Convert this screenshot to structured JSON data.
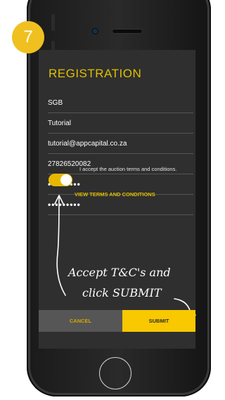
{
  "step": {
    "number": "7"
  },
  "form": {
    "title": "REGISTRATION",
    "fields": [
      {
        "value": "SGB"
      },
      {
        "value": "Tutorial"
      },
      {
        "value": "tutorial@appcapital.co.za"
      },
      {
        "value": "27826520082"
      },
      {
        "value": "•••••••••"
      },
      {
        "value": "•••••••••"
      }
    ],
    "terms_toggle_on": true,
    "terms_label": "I accept the auction terms and conditions.",
    "terms_link": "VIEW TERMS AND CONDITIONS"
  },
  "annotation": {
    "line1": "Accept T&C's and",
    "line2": "click SUBMIT"
  },
  "buttons": {
    "cancel": "CANCEL",
    "submit": "SUBMIT"
  },
  "colors": {
    "accent": "#f8c800",
    "screen_bg": "#2f2f2f"
  }
}
